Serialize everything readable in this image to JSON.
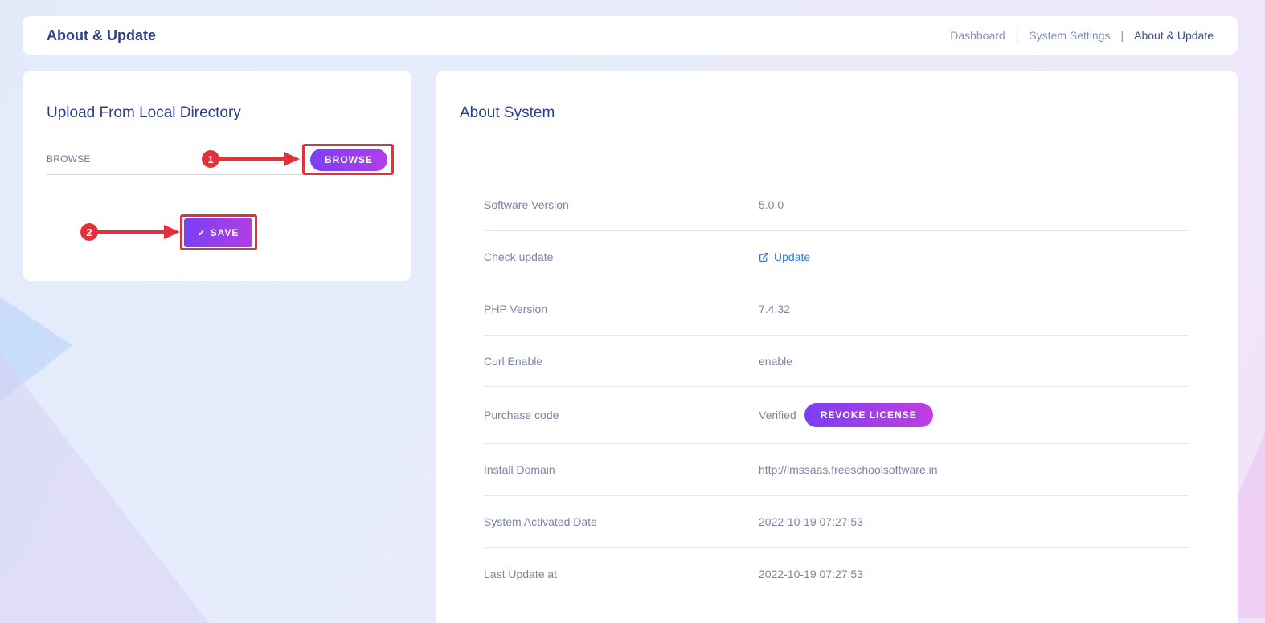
{
  "header": {
    "title": "About & Update",
    "breadcrumb": [
      "Dashboard",
      "System Settings",
      "About & Update"
    ]
  },
  "upload": {
    "title": "Upload From Local Directory",
    "field_label": "BROWSE",
    "browse_button": "BROWSE",
    "save_button": "SAVE",
    "save_icon": "checkmark-icon"
  },
  "annotations": {
    "step1": "1",
    "step2": "2",
    "color": "#e5303a"
  },
  "about": {
    "title": "About System",
    "rows": [
      {
        "label": "Software Version",
        "value": "5.0.0"
      },
      {
        "label": "Check update",
        "value": "Update",
        "icon": "external-link-icon"
      },
      {
        "label": "PHP Version",
        "value": "7.4.32"
      },
      {
        "label": "Curl Enable",
        "value": "enable"
      },
      {
        "label": "Purchase code",
        "value": "Verified",
        "button": "REVOKE LICENSE"
      },
      {
        "label": "Install Domain",
        "value": "http://lmssaas.freeschoolsoftware.in"
      },
      {
        "label": "System Activated Date",
        "value": "2022-10-19 07:27:53"
      },
      {
        "label": "Last Update at",
        "value": "2022-10-19 07:27:53"
      }
    ]
  },
  "colors": {
    "accent_start": "#7b3ff2",
    "accent_end": "#b23ee6",
    "title": "#2f3f87",
    "link": "#2f7be8"
  }
}
